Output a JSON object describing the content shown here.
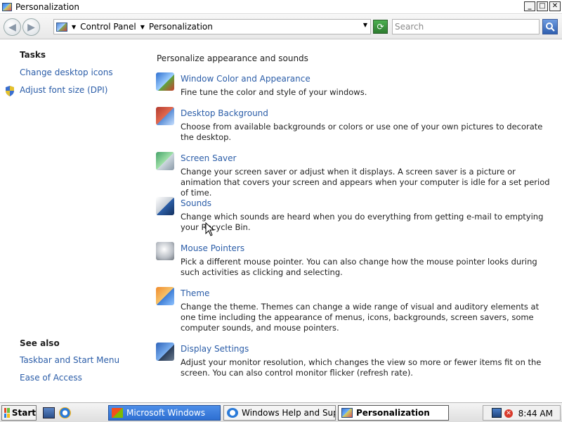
{
  "window": {
    "title": "Personalization"
  },
  "titlebar_buttons": {
    "minimize": "_",
    "maximize": "□",
    "close": "✕"
  },
  "address": {
    "crumbs": [
      "Control Panel",
      "Personalization"
    ],
    "search_placeholder": "Search"
  },
  "left_pane": {
    "tasks_heading": "Tasks",
    "tasks": [
      {
        "label": "Change desktop icons"
      },
      {
        "label": "Adjust font size (DPI)",
        "icon": "shield-icon"
      }
    ],
    "see_also_heading": "See also",
    "see_also": [
      {
        "label": "Taskbar and Start Menu"
      },
      {
        "label": "Ease of Access"
      }
    ]
  },
  "main": {
    "heading": "Personalize appearance and sounds",
    "items": [
      {
        "title": "Window Color and Appearance",
        "desc": "Fine tune the color and style of your windows.",
        "icon": "window-color-icon"
      },
      {
        "title": "Desktop Background",
        "desc": "Choose from available backgrounds or colors or use one of your own pictures to decorate the desktop.",
        "icon": "desktop-background-icon"
      },
      {
        "title": "Screen Saver",
        "desc": "Change your screen saver or adjust when it displays. A screen saver is a picture or animation that covers your screen and appears when your computer is idle for a set period of time.",
        "icon": "screen-saver-icon"
      },
      {
        "title": "Sounds",
        "desc": "Change which sounds are heard when you do everything from getting e-mail to emptying your Recycle Bin.",
        "icon": "sounds-icon"
      },
      {
        "title": "Mouse Pointers",
        "desc": "Pick a different mouse pointer. You can also change how the mouse pointer looks during such activities as clicking and selecting.",
        "icon": "mouse-icon"
      },
      {
        "title": "Theme",
        "desc": "Change the theme. Themes can change a wide range of visual and auditory elements at one time including the appearance of menus, icons, backgrounds, screen savers, some computer sounds, and mouse pointers.",
        "icon": "theme-icon"
      },
      {
        "title": "Display Settings",
        "desc": "Adjust your monitor resolution, which changes the view so more or fewer items fit on the screen. You can also control monitor flicker (refresh rate).",
        "icon": "display-settings-icon"
      }
    ]
  },
  "taskbar": {
    "start_label": "Start",
    "tasks": [
      {
        "label": "Microsoft Windows",
        "state": "active-blue"
      },
      {
        "label": "Windows Help and Sup...",
        "state": "normal"
      },
      {
        "label": "Personalization",
        "state": "pressed"
      }
    ],
    "clock": "8:44 AM"
  },
  "colors": {
    "link": "#2b5da8",
    "text": "#1e1e1e",
    "taskbar_active": "#2e6fd2"
  }
}
